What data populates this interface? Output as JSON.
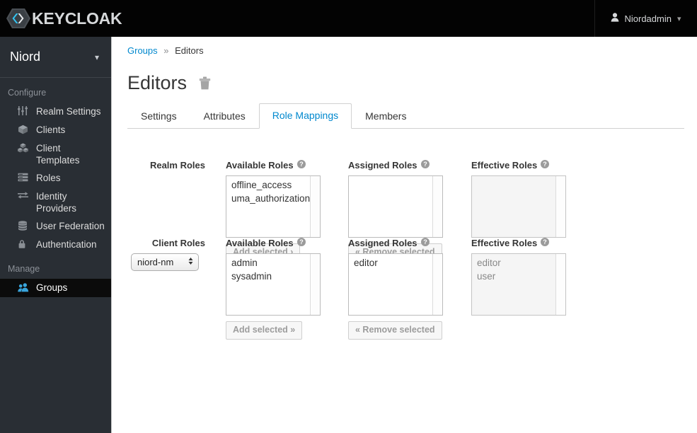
{
  "topbar": {
    "brand_text": "KEYCLOAK",
    "brand_icon": "keycloak-logo-icon",
    "user_icon": "user-icon",
    "user_name": "Niordadmin",
    "user_caret_icon": "chevron-down-icon"
  },
  "sidebar": {
    "realm_name": "Niord",
    "realm_caret_icon": "chevron-down-icon",
    "sections": [
      {
        "heading": "Configure",
        "items": [
          {
            "label": "Realm Settings",
            "icon": "sliders-icon",
            "active": false
          },
          {
            "label": "Clients",
            "icon": "cube-icon",
            "active": false
          },
          {
            "label": "Client Templates",
            "icon": "cubes-icon",
            "active": false
          },
          {
            "label": "Roles",
            "icon": "server-icon",
            "active": false
          },
          {
            "label": "Identity Providers",
            "icon": "exchange-icon",
            "active": false
          },
          {
            "label": "User Federation",
            "icon": "database-icon",
            "active": false
          },
          {
            "label": "Authentication",
            "icon": "lock-icon",
            "active": false
          }
        ]
      },
      {
        "heading": "Manage",
        "items": [
          {
            "label": "Groups",
            "icon": "users-icon",
            "active": true
          }
        ]
      }
    ]
  },
  "breadcrumb": {
    "root_label": "Groups",
    "separator": "»",
    "current_label": "Editors"
  },
  "page": {
    "title": "Editors",
    "delete_icon": "trash-icon"
  },
  "tabs": [
    {
      "label": "Settings",
      "active": false
    },
    {
      "label": "Attributes",
      "active": false
    },
    {
      "label": "Role Mappings",
      "active": true
    },
    {
      "label": "Members",
      "active": false
    }
  ],
  "realm_roles": {
    "row_label": "Realm Roles",
    "available": {
      "label": "Available Roles",
      "help_icon": "help-circle-icon",
      "options": [
        "offline_access",
        "uma_authorization"
      ],
      "add_button": "Add selected ›"
    },
    "assigned": {
      "label": "Assigned Roles",
      "help_icon": "help-circle-icon",
      "options": [],
      "remove_button": "« Remove selected"
    },
    "effective": {
      "label": "Effective Roles",
      "help_icon": "help-circle-icon",
      "options": []
    }
  },
  "client_roles": {
    "row_label": "Client Roles",
    "client_select_value": "niord-nm",
    "client_select_icon": "stepper-arrows-icon",
    "available": {
      "label": "Available Roles",
      "help_icon": "help-circle-icon",
      "options": [
        "admin",
        "sysadmin"
      ],
      "add_button": "Add selected »"
    },
    "assigned": {
      "label": "Assigned Roles",
      "help_icon": "help-circle-icon",
      "options": [
        "editor"
      ],
      "remove_button": "« Remove selected"
    },
    "effective": {
      "label": "Effective Roles",
      "help_icon": "help-circle-icon",
      "options": [
        "editor",
        "user"
      ]
    }
  },
  "colors": {
    "topbar_bg": "#030303",
    "sidebar_bg": "#292e34",
    "accent_blue": "#0088ce",
    "active_nav_bg": "#0b0b0b"
  }
}
